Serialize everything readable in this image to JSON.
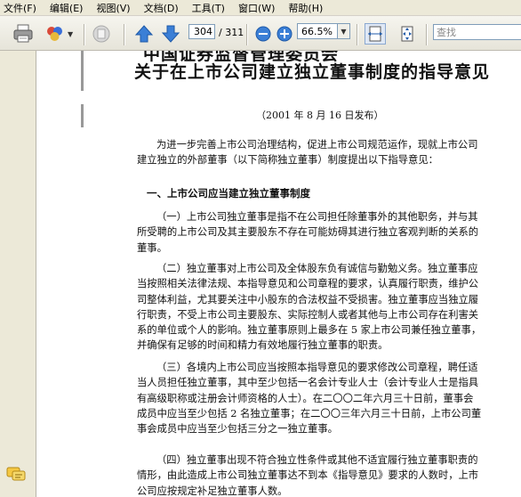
{
  "menu": [
    "文件(F)",
    "编辑(E)",
    "视图(V)",
    "文档(D)",
    "工具(T)",
    "窗口(W)",
    "帮助(H)"
  ],
  "toolbar": {
    "current_page": "304",
    "page_total": "/ 311",
    "zoom": "66.5%",
    "search_placeholder": "查找",
    "icons": [
      "print-icon",
      "collaborate-icon",
      "document-icon",
      "prev-page-icon",
      "next-page-icon",
      "zoom-out-icon",
      "zoom-in-icon",
      "fit-width-icon",
      "fit-page-icon"
    ]
  },
  "document": {
    "cut_header": "中国证券监督管理委员会",
    "title": "关于在上市公司建立独立董事制度的指导意见",
    "date": "（2001 年 8 月 16 日发布）",
    "intro": [
      "为进一步完善上市公司治理结构，促进上市公司规范运作，现就上市公司",
      "建立独立的外部董事（以下简称独立董事）制度提出以下指导意见："
    ],
    "heading1": "一、上市公司应当建立独立董事制度",
    "p1": [
      "（一）上市公司独立董事是指不在公司担任除董事外的其他职务，并与其",
      "所受聘的上市公司及其主要股东不存在可能妨碍其进行独立客观判断的关系的",
      "董事。"
    ],
    "p2": [
      "（二）独立董事对上市公司及全体股东负有诚信与勤勉义务。独立董事应",
      "当按照相关法律法规、本指导意见和公司章程的要求，认真履行职责，维护公",
      "司整体利益，尤其要关注中小股东的合法权益不受损害。独立董事应当独立履",
      "行职责，不受上市公司主要股东、实际控制人或者其他与上市公司存在利害关",
      "系的单位或个人的影响。独立董事原则上最多在 5 家上市公司兼任独立董事，",
      "并确保有足够的时间和精力有效地履行独立董事的职责。"
    ],
    "p3": [
      "（三）各境内上市公司应当按照本指导意见的要求修改公司章程，聘任适",
      "当人员担任独立董事，其中至少包括一名会计专业人士（会计专业人士是指具",
      "有高级职称或注册会计师资格的人士）。在二〇〇二年六月三十日前，董事会",
      "成员中应当至少包括 2 名独立董事；在二〇〇三年六月三十日前，上市公司董",
      "事会成员中应当至少包括三分之一独立董事。"
    ],
    "p4": [
      "（四）独立董事出现不符合独立性条件或其他不适宜履行独立董事职责的",
      "情形，由此造成上市公司独立董事达不到本《指导意见》要求的人数时，上市",
      "公司应按规定补足独立董事人数。"
    ]
  }
}
